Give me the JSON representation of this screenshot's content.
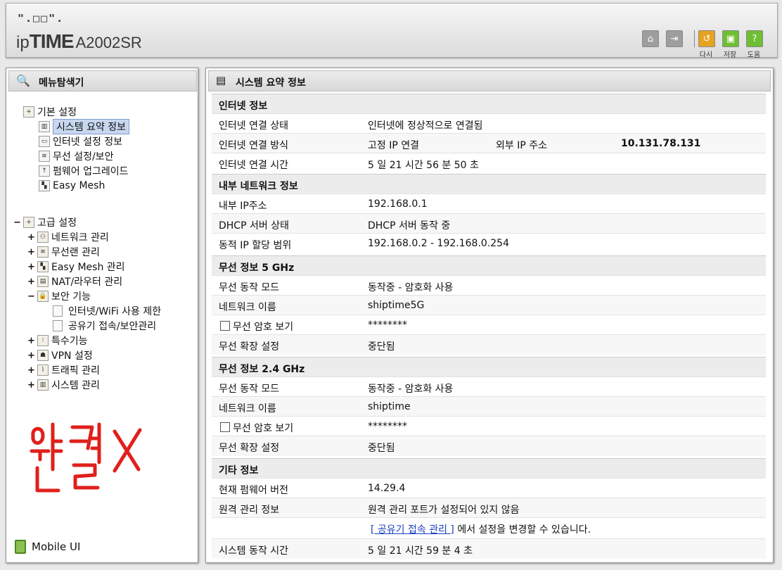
{
  "header": {
    "logo_dots": "\".□□\".",
    "brand_prefix": "ip",
    "brand_name": "TIME",
    "model": "A2002SR",
    "buttons": {
      "reload_label": "다시",
      "save_label": "저장",
      "help_label": "도움"
    }
  },
  "sidebar": {
    "title": "메뉴탐색기",
    "basic_group": "기본 설정",
    "basic_items": [
      "시스템 요약 정보",
      "인터넷 설정 정보",
      "무선 설정/보안",
      "펌웨어 업그레이드",
      "Easy Mesh"
    ],
    "advanced_group": "고급 설정",
    "advanced_items": [
      "네트워크 관리",
      "무선랜 관리",
      "Easy Mesh 관리",
      "NAT/라우터 관리",
      "보안 기능"
    ],
    "security_subitems": [
      "인터넷/WiFi 사용 제한",
      "공유기 접속/보안관리"
    ],
    "advanced_items_after": [
      "특수기능",
      "VPN 설정",
      "트래픽 관리",
      "시스템 관리"
    ],
    "mobile_ui": "Mobile UI",
    "expand_minus": "−",
    "expand_plus": "+"
  },
  "main": {
    "title": "시스템 요약 정보",
    "internet": {
      "section": "인터넷 정보",
      "status_key": "인터넷 연결 상태",
      "status_val": "인터넷에 정상적으로 연결됨",
      "method_key": "인터넷 연결 방식",
      "method_val": "고정 IP 연결",
      "ext_ip_key": "외부 IP 주소",
      "ext_ip_val": "10.131.78.131",
      "time_key": "인터넷 연결 시간",
      "time_val": "5 일 21 시간 56 분 50 초"
    },
    "lan": {
      "section": "내부 네트워크 정보",
      "ip_key": "내부 IP주소",
      "ip_val": "192.168.0.1",
      "dhcp_key": "DHCP 서버 상태",
      "dhcp_val": "DHCP 서버 동작 중",
      "range_key": "동적 IP 할당 범위",
      "range_val": "192.168.0.2 -  192.168.0.254"
    },
    "wifi5": {
      "section": "무선 정보 5 GHz",
      "mode_key": "무선 동작 모드",
      "mode_val": "동작중 - 암호화 사용",
      "ssid_key": "네트워크 이름",
      "ssid_val": "shiptime5G",
      "pw_key": "무선 암호 보기",
      "pw_val": "********",
      "ext_key": "무선 확장 설정",
      "ext_val": "중단됨"
    },
    "wifi24": {
      "section": "무선 정보 2.4 GHz",
      "mode_key": "무선 동작 모드",
      "mode_val": "동작중 - 암호화 사용",
      "ssid_key": "네트워크 이름",
      "ssid_val": "shiptime",
      "pw_key": "무선 암호 보기",
      "pw_val": "********",
      "ext_key": "무선 확장 설정",
      "ext_val": "중단됨"
    },
    "etc": {
      "section": "기타 정보",
      "fw_key": "현재 펌웨어 버전",
      "fw_val": "14.29.4",
      "remote_key": "원격 관리 정보",
      "remote_val": "원격 관리 포트가 설정되어 있지 않음",
      "remote_link": "[ 공유기 접속 관리 ]",
      "remote_hint": " 에서 설정을 변경할 수 있습니다.",
      "uptime_key": "시스템 동작 시간",
      "uptime_val": "5 일 21 시간 59 분 4 초"
    }
  },
  "colors": {
    "annotation": "#e0201b",
    "selection": "#c7d7ef",
    "link": "#1a3fbf"
  }
}
